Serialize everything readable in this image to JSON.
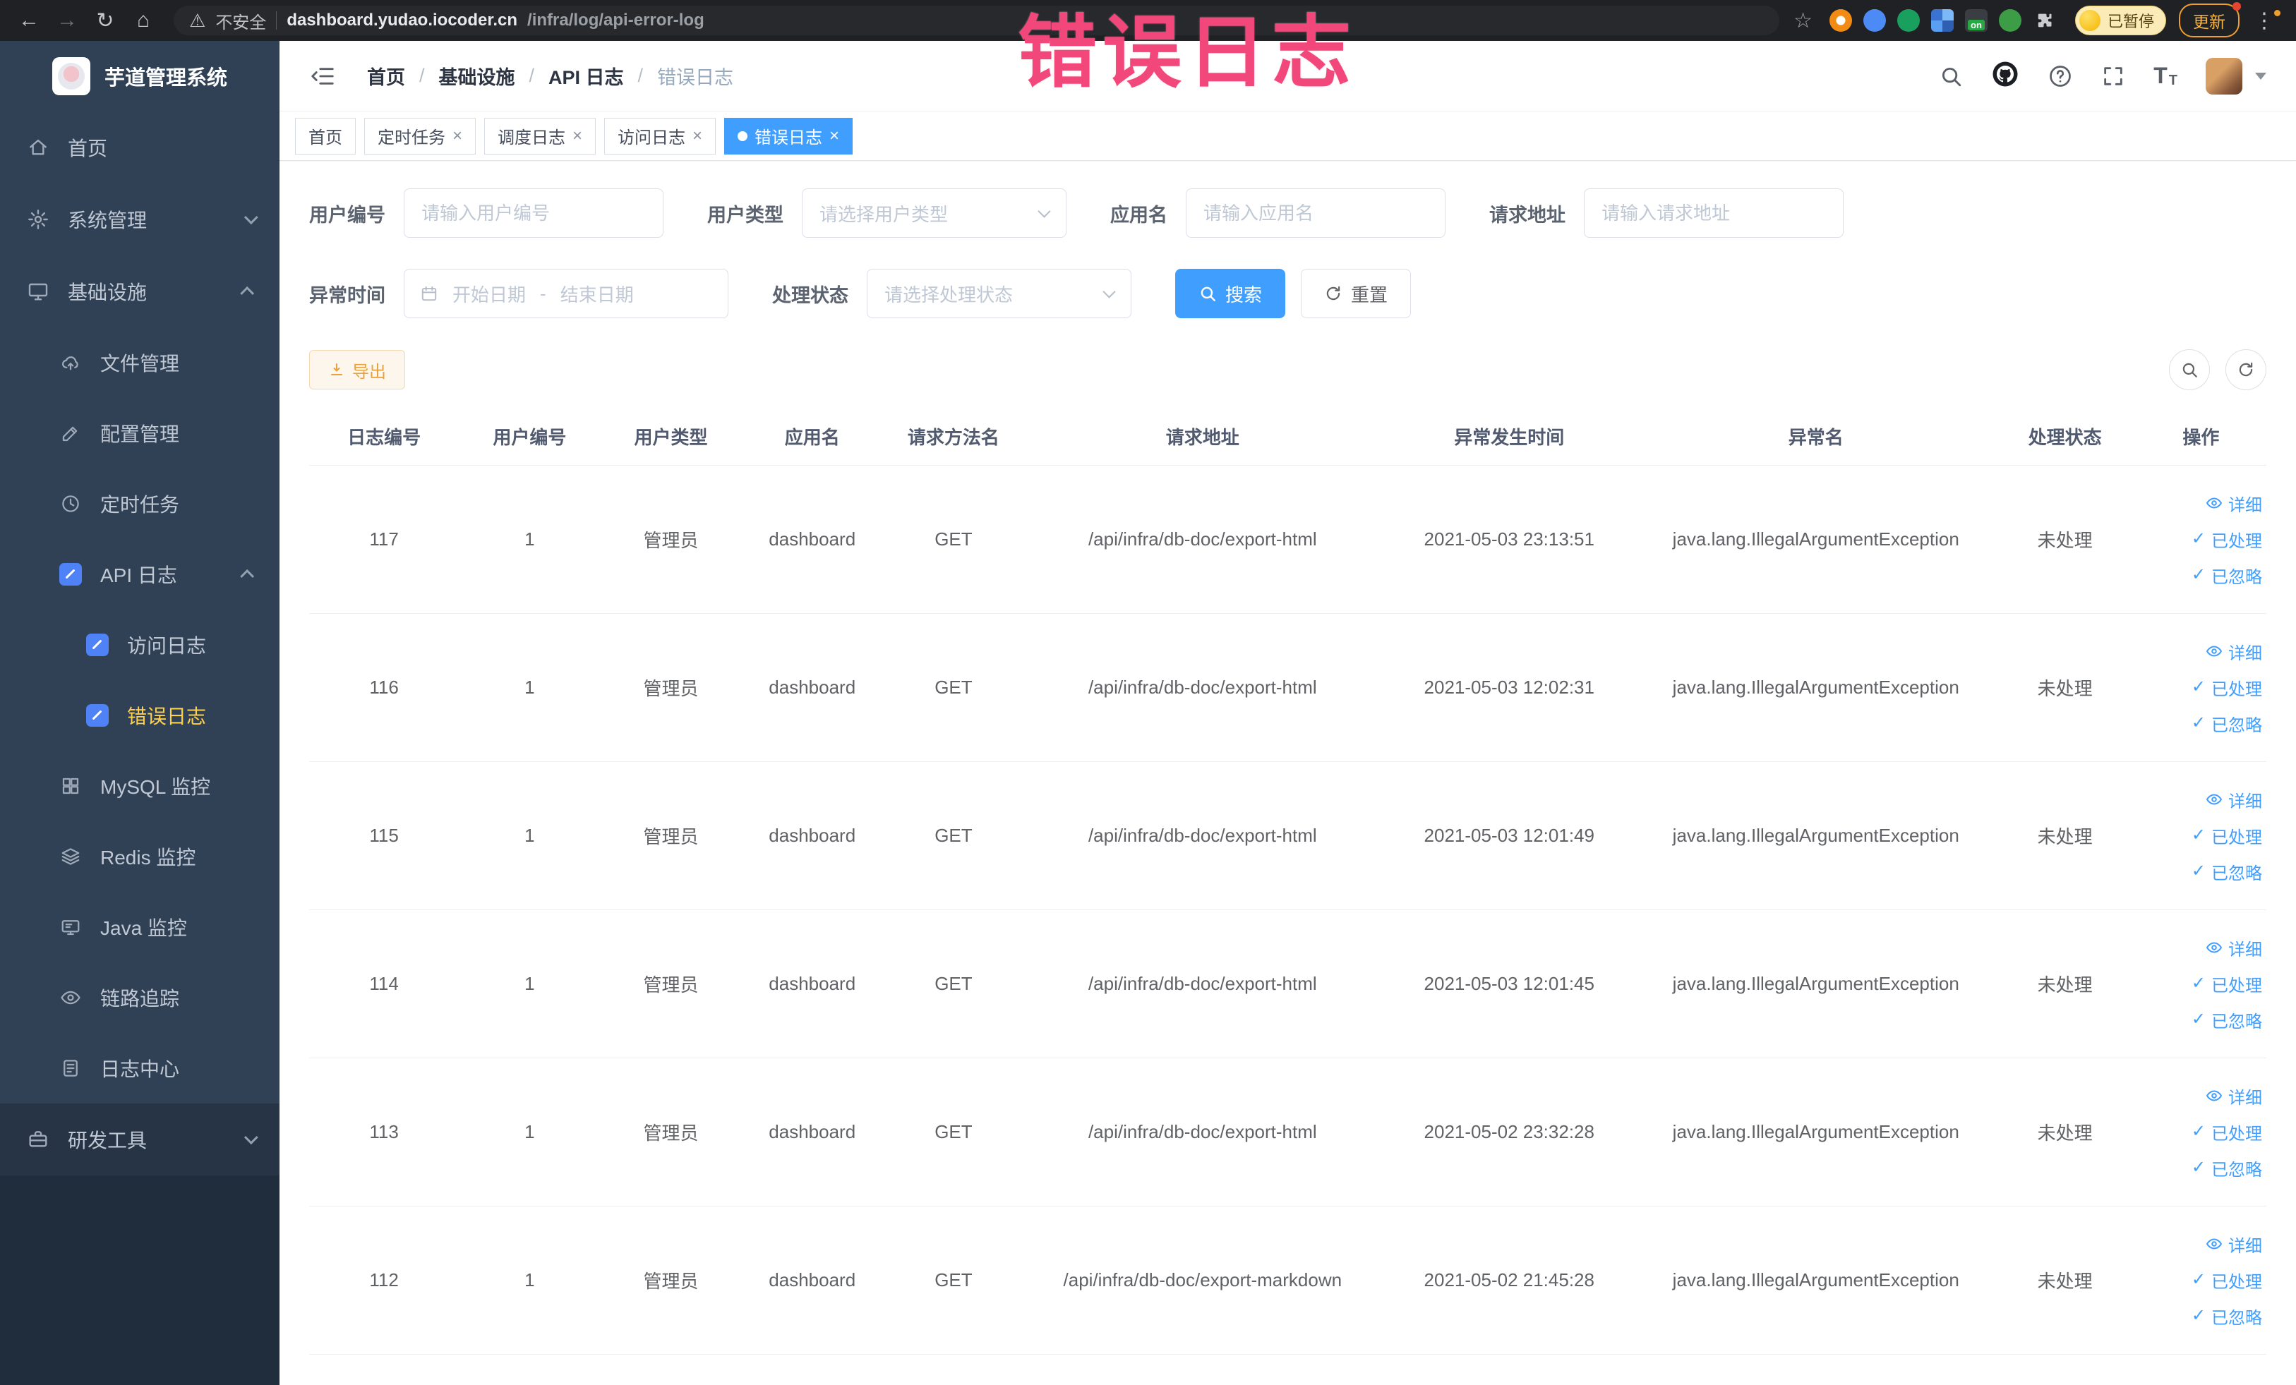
{
  "browser": {
    "security_label": "不安全",
    "url_domain": "dashboard.yudao.iocoder.cn",
    "url_path": "/infra/log/api-error-log",
    "paused_badge": "已暂停",
    "update_button": "更新",
    "proxy_badge": "on"
  },
  "annotation": "错误日志",
  "sidebar": {
    "logo_title": "芋道管理系统",
    "items": [
      {
        "label": "首页"
      },
      {
        "label": "系统管理"
      },
      {
        "label": "基础设施"
      },
      {
        "label": "文件管理"
      },
      {
        "label": "配置管理"
      },
      {
        "label": "定时任务"
      },
      {
        "label": "API 日志"
      },
      {
        "label": "访问日志"
      },
      {
        "label": "错误日志"
      },
      {
        "label": "MySQL 监控"
      },
      {
        "label": "Redis 监控"
      },
      {
        "label": "Java 监控"
      },
      {
        "label": "链路追踪"
      },
      {
        "label": "日志中心"
      },
      {
        "label": "研发工具"
      }
    ]
  },
  "breadcrumb": {
    "separator": "/",
    "items": [
      "首页",
      "基础设施",
      "API 日志",
      "错误日志"
    ]
  },
  "tabs": [
    {
      "label": "首页"
    },
    {
      "label": "定时任务"
    },
    {
      "label": "调度日志"
    },
    {
      "label": "访问日志"
    },
    {
      "label": "错误日志"
    }
  ],
  "filters": {
    "user_id": {
      "label": "用户编号",
      "placeholder": "请输入用户编号"
    },
    "user_type": {
      "label": "用户类型",
      "placeholder": "请选择用户类型"
    },
    "app_name": {
      "label": "应用名",
      "placeholder": "请输入应用名"
    },
    "request_url": {
      "label": "请求地址",
      "placeholder": "请输入请求地址"
    },
    "exception_time": {
      "label": "异常时间",
      "start_placeholder": "开始日期",
      "separator": "-",
      "end_placeholder": "结束日期"
    },
    "process_status": {
      "label": "处理状态",
      "placeholder": "请选择处理状态"
    },
    "search_label": "搜索",
    "reset_label": "重置"
  },
  "toolbar": {
    "export_label": "导出"
  },
  "table": {
    "columns": [
      "日志编号",
      "用户编号",
      "用户类型",
      "应用名",
      "请求方法名",
      "请求地址",
      "异常发生时间",
      "异常名",
      "处理状态",
      "操作"
    ],
    "actions": {
      "detail": "详细",
      "processed": "已处理",
      "ignored": "已忽略"
    },
    "rows": [
      {
        "log_id": "117",
        "user_id": "1",
        "user_type": "管理员",
        "app_name": "dashboard",
        "method": "GET",
        "request_url": "/api/infra/db-doc/export-html",
        "exception_time": "2021-05-03 23:13:51",
        "exception_name": "java.lang.IllegalArgumentException",
        "process_status": "未处理"
      },
      {
        "log_id": "116",
        "user_id": "1",
        "user_type": "管理员",
        "app_name": "dashboard",
        "method": "GET",
        "request_url": "/api/infra/db-doc/export-html",
        "exception_time": "2021-05-03 12:02:31",
        "exception_name": "java.lang.IllegalArgumentException",
        "process_status": "未处理"
      },
      {
        "log_id": "115",
        "user_id": "1",
        "user_type": "管理员",
        "app_name": "dashboard",
        "method": "GET",
        "request_url": "/api/infra/db-doc/export-html",
        "exception_time": "2021-05-03 12:01:49",
        "exception_name": "java.lang.IllegalArgumentException",
        "process_status": "未处理"
      },
      {
        "log_id": "114",
        "user_id": "1",
        "user_type": "管理员",
        "app_name": "dashboard",
        "method": "GET",
        "request_url": "/api/infra/db-doc/export-html",
        "exception_time": "2021-05-03 12:01:45",
        "exception_name": "java.lang.IllegalArgumentException",
        "process_status": "未处理"
      },
      {
        "log_id": "113",
        "user_id": "1",
        "user_type": "管理员",
        "app_name": "dashboard",
        "method": "GET",
        "request_url": "/api/infra/db-doc/export-html",
        "exception_time": "2021-05-02 23:32:28",
        "exception_name": "java.lang.IllegalArgumentException",
        "process_status": "未处理"
      },
      {
        "log_id": "112",
        "user_id": "1",
        "user_type": "管理员",
        "app_name": "dashboard",
        "method": "GET",
        "request_url": "/api/infra/db-doc/export-markdown",
        "exception_time": "2021-05-02 21:45:28",
        "exception_name": "java.lang.IllegalArgumentException",
        "process_status": "未处理"
      }
    ]
  }
}
